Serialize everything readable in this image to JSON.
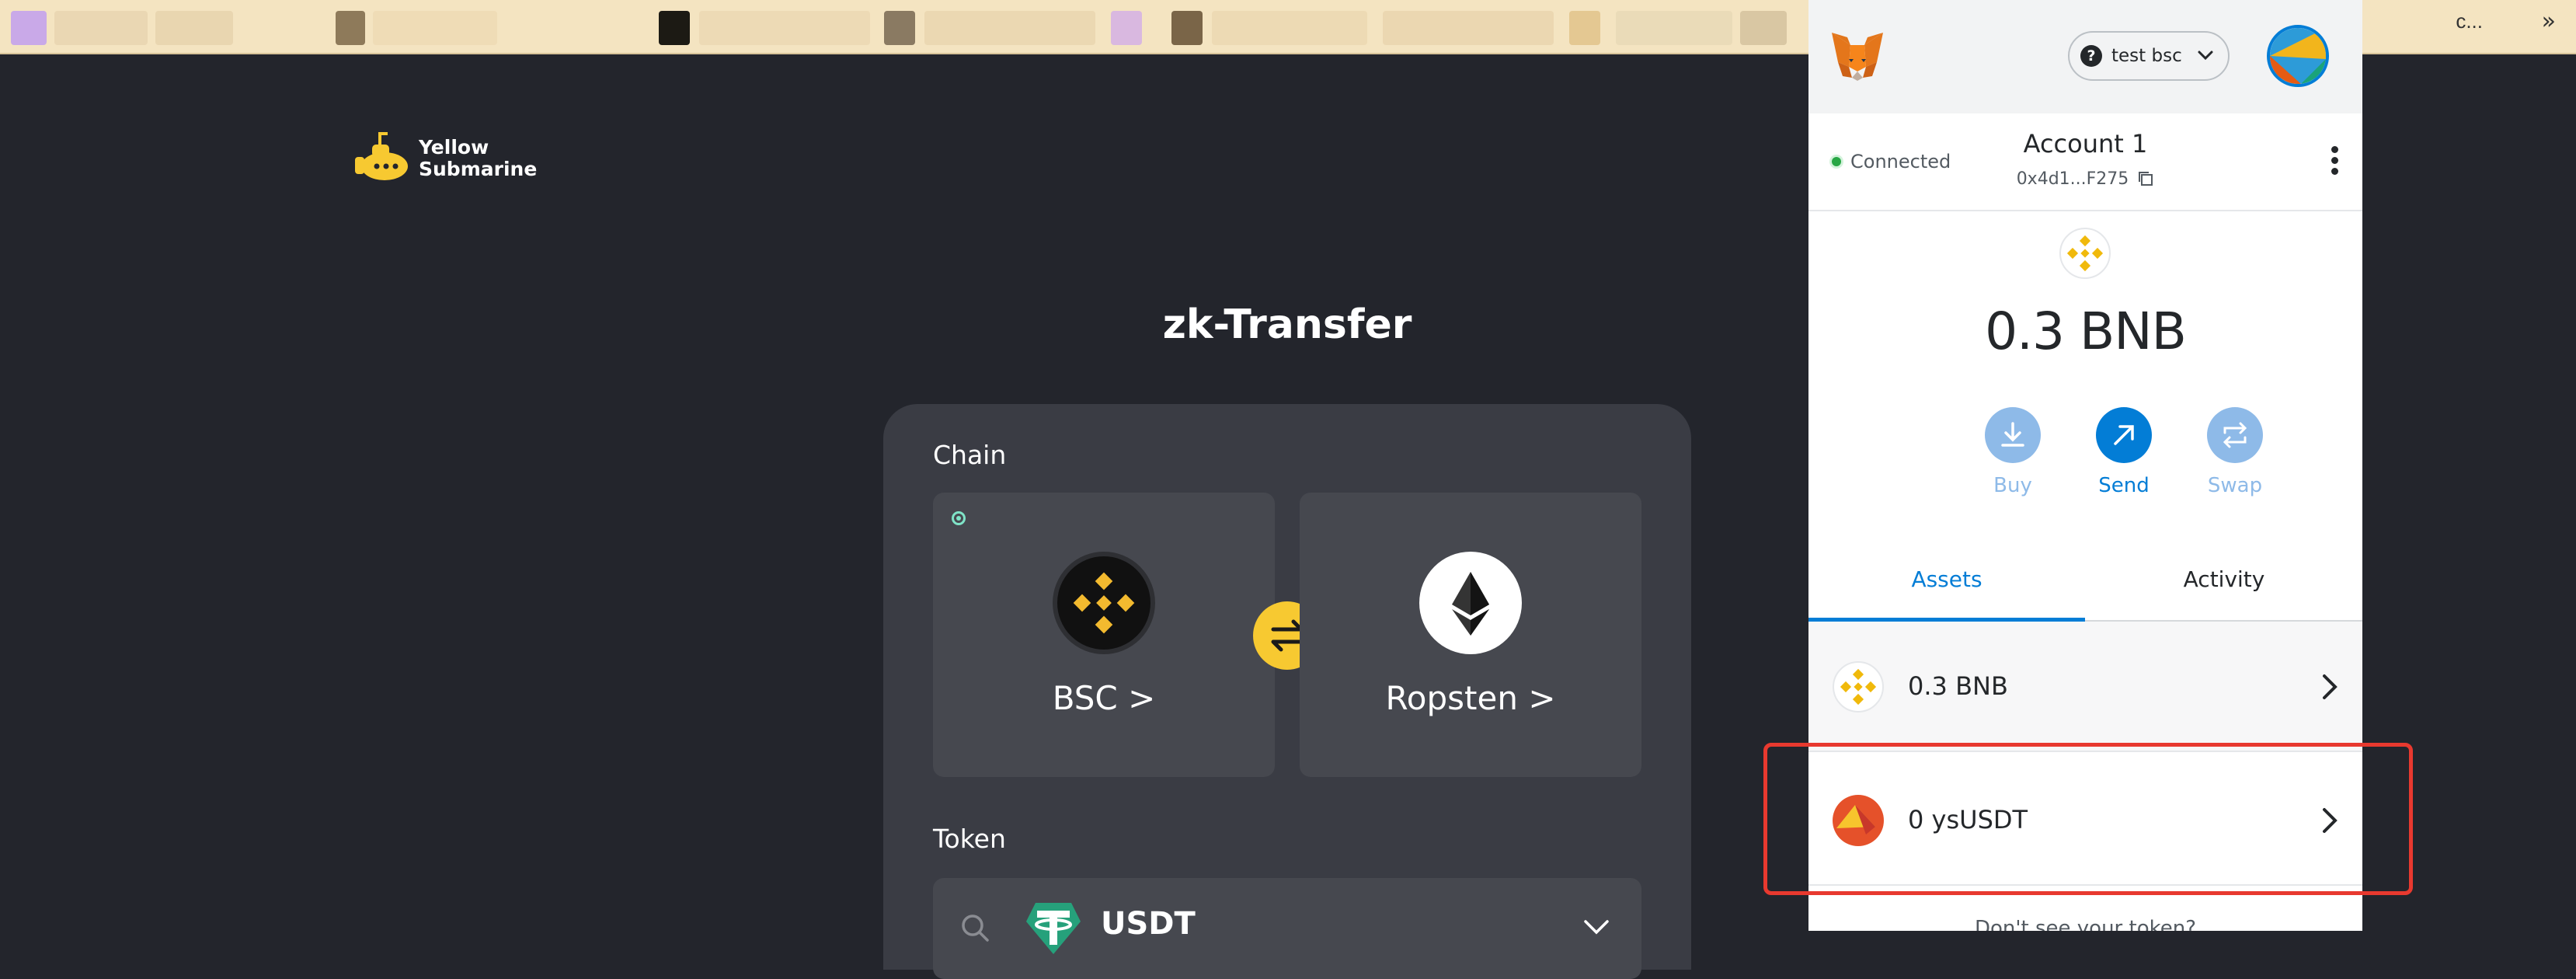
{
  "browser": {
    "bookmark_tail_text": "c...",
    "bookmark_overflow": "»"
  },
  "app": {
    "logo_line1": "Yellow",
    "logo_line2": "Submarine",
    "page_title": "zk-Transfer",
    "chain_label": "Chain",
    "chains": [
      {
        "name": "BSC",
        "icon": "bnb-logo-icon",
        "selected": true
      },
      {
        "name": "Ropsten",
        "icon": "ethereum-logo-icon",
        "selected": false
      }
    ],
    "chain_arrow": ">",
    "token_label": "Token",
    "token": {
      "name": "USDT",
      "icon": "tether-icon"
    },
    "colors": {
      "accent": "#f7c931",
      "card": "#3a3c44",
      "bg": "#23252c"
    }
  },
  "metamask": {
    "network": "test bsc",
    "network_icon_glyph": "?",
    "connection_status": "Connected",
    "account_name": "Account 1",
    "account_address": "0x4d1...F275",
    "balance": "0.3 BNB",
    "actions": [
      {
        "label": "Buy",
        "icon": "download-icon",
        "enabled": false
      },
      {
        "label": "Send",
        "icon": "send-arrow-icon",
        "enabled": true
      },
      {
        "label": "Swap",
        "icon": "swap-icon",
        "enabled": false
      }
    ],
    "tabs": [
      {
        "label": "Assets",
        "active": true
      },
      {
        "label": "Activity",
        "active": false
      }
    ],
    "assets": [
      {
        "label": "0.3 BNB",
        "icon": "bnb-token-icon"
      },
      {
        "label": "0 ysUSDT",
        "icon": "ysusdt-token-icon"
      }
    ],
    "more_tokens_text": "Don't see your token?",
    "colors": {
      "primary": "#037dd6",
      "disabled": "#8ebae8",
      "highlight": "#e8392f"
    }
  }
}
